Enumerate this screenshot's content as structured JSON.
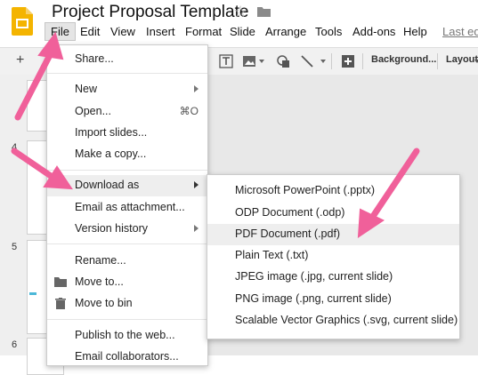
{
  "app": {
    "title": "Project Proposal Template",
    "last_edit": "Last edi"
  },
  "menubar": [
    "File",
    "Edit",
    "View",
    "Insert",
    "Format",
    "Slide",
    "Arrange",
    "Tools",
    "Add-ons",
    "Help"
  ],
  "toolbar": {
    "plus": "+",
    "background_label": "Background...",
    "layout_label": "Layout"
  },
  "filmstrip": {
    "slide_numbers": [
      "4",
      "5",
      "6"
    ]
  },
  "file_menu": {
    "items": [
      {
        "label": "Share..."
      },
      {
        "label": "New",
        "submenu": true
      },
      {
        "label": "Open...",
        "shortcut": "⌘O"
      },
      {
        "label": "Import slides..."
      },
      {
        "label": "Make a copy..."
      },
      {
        "label": "Download as",
        "submenu": true,
        "highlighted": true
      },
      {
        "label": "Email as attachment..."
      },
      {
        "label": "Version history",
        "submenu": true
      },
      {
        "label": "Rename..."
      },
      {
        "label": "Move to...",
        "icon": "folder-icon"
      },
      {
        "label": "Move to bin",
        "icon": "trash-icon"
      },
      {
        "label": "Publish to the web..."
      },
      {
        "label": "Email collaborators..."
      }
    ]
  },
  "download_menu": {
    "items": [
      "Microsoft PowerPoint (.pptx)",
      "ODP Document (.odp)",
      "PDF Document (.pdf)",
      "Plain Text (.txt)",
      "JPEG image (.jpg, current slide)",
      "PNG image (.png, current slide)",
      "Scalable Vector Graphics (.svg, current slide)"
    ],
    "highlighted_index": 2
  },
  "colors": {
    "annotation_arrow": "#f0609a",
    "slides_yellow": "#f4b400"
  }
}
